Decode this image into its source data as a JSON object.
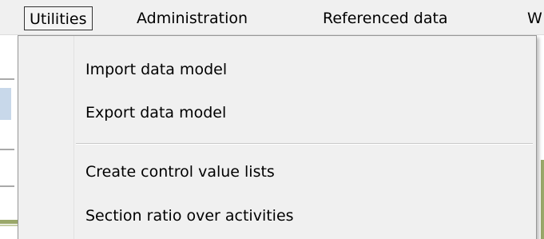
{
  "menubar": {
    "items": [
      {
        "label": "Utilities",
        "active": true
      },
      {
        "label": "Administration",
        "active": false
      },
      {
        "label": "Referenced data",
        "active": false
      },
      {
        "label": "W",
        "active": false
      }
    ]
  },
  "dropdown": {
    "items": [
      {
        "label": "Import data model"
      },
      {
        "label": "Export data model"
      },
      {
        "label": "Create control value lists"
      },
      {
        "label": "Section ratio over activities"
      }
    ]
  }
}
